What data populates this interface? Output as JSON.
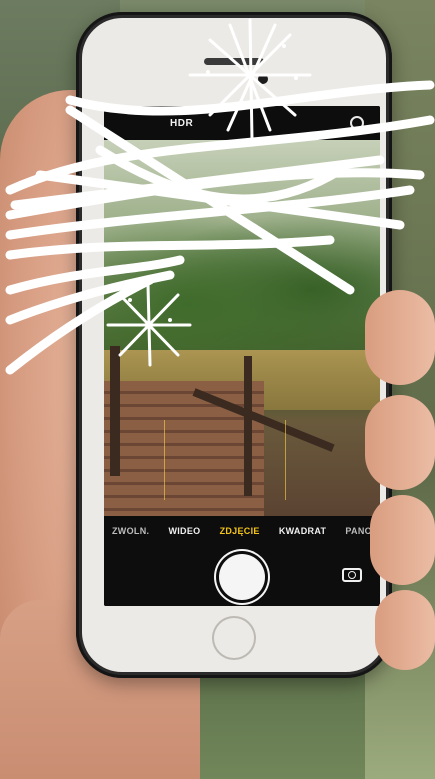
{
  "camera_app": {
    "top_bar": {
      "hdr_label": "HDR"
    },
    "modes": [
      {
        "label": "ZWOLN.",
        "state": "dim"
      },
      {
        "label": "WIDEO",
        "state": "normal"
      },
      {
        "label": "ZDJĘCIE",
        "state": "active"
      },
      {
        "label": "KWADRAT",
        "state": "normal"
      },
      {
        "label": "PANO",
        "state": "dim"
      }
    ]
  },
  "colors": {
    "active_mode": "#f5c518",
    "overlay_scribble": "#ffffff"
  },
  "icons": {
    "shutter": "shutter-button-circle",
    "switch_camera": "camera-flip-icon",
    "timer": "timer-icon",
    "sparkle": "sparkle-burst-icon"
  }
}
